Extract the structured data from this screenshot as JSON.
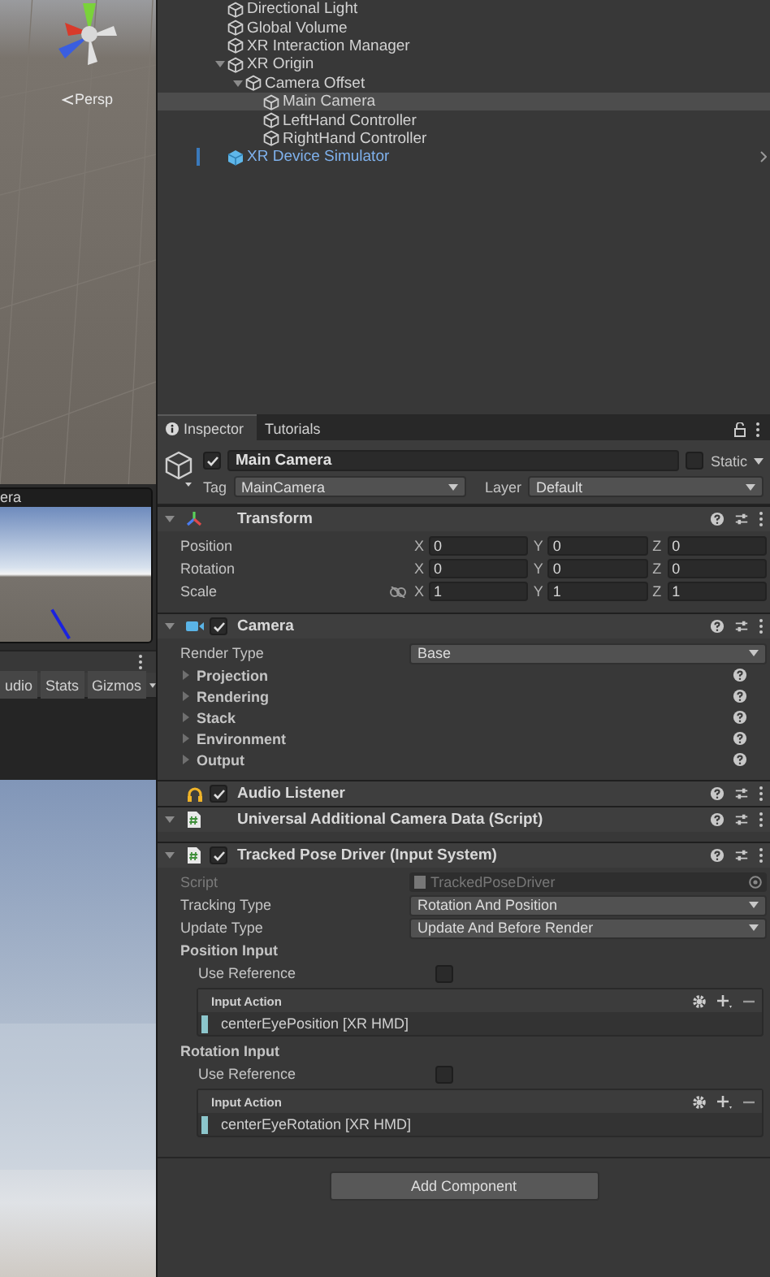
{
  "scene_view": {
    "view_label": "Persp"
  },
  "camera_preview": {
    "title": "era"
  },
  "game_toolbar": {
    "buttons": [
      "udio",
      "Stats",
      "Gizmos"
    ]
  },
  "hierarchy": {
    "items": [
      {
        "name": "Directional Light",
        "kind": "object",
        "selected": false
      },
      {
        "name": "Global Volume",
        "kind": "object",
        "selected": false
      },
      {
        "name": "XR Interaction Manager",
        "kind": "object",
        "selected": false
      },
      {
        "name": "XR Origin",
        "kind": "object",
        "selected": false,
        "expanded": true,
        "children": [
          {
            "name": "Camera Offset",
            "kind": "object",
            "selected": false,
            "expanded": true,
            "children": [
              {
                "name": "Main Camera",
                "kind": "object",
                "selected": true
              },
              {
                "name": "LeftHand Controller",
                "kind": "object",
                "selected": false
              },
              {
                "name": "RightHand Controller",
                "kind": "object",
                "selected": false
              }
            ]
          }
        ]
      },
      {
        "name": "XR Device Simulator",
        "kind": "prefab",
        "selected": false
      }
    ]
  },
  "inspector": {
    "tabs": [
      {
        "label": "Inspector",
        "selected": true
      },
      {
        "label": "Tutorials",
        "selected": false
      }
    ],
    "object": {
      "active": true,
      "name": "Main Camera",
      "static_label": "Static",
      "static": false,
      "tag_label": "Tag",
      "tag": "MainCamera",
      "layer_label": "Layer",
      "layer": "Default"
    },
    "components": [
      {
        "title": "Transform",
        "kind": "transform",
        "expanded": true,
        "rows": [
          {
            "kind": "vector",
            "label": "Position",
            "values": [
              {
                "axis": "X",
                "value": "0"
              },
              {
                "axis": "Y",
                "value": "0"
              },
              {
                "axis": "Z",
                "value": "0"
              }
            ]
          },
          {
            "kind": "vector",
            "label": "Rotation",
            "values": [
              {
                "axis": "X",
                "value": "0"
              },
              {
                "axis": "Y",
                "value": "0"
              },
              {
                "axis": "Z",
                "value": "0"
              }
            ]
          },
          {
            "kind": "vector",
            "label": "Scale",
            "constrained": false,
            "values": [
              {
                "axis": "X",
                "value": "1"
              },
              {
                "axis": "Y",
                "value": "1"
              },
              {
                "axis": "Z",
                "value": "1"
              }
            ]
          }
        ]
      },
      {
        "title": "Camera",
        "kind": "camera",
        "enabled": true,
        "expanded": true,
        "rows": [
          {
            "kind": "dropdown",
            "label": "Render Type",
            "value": "Base"
          },
          {
            "kind": "foldout",
            "label": "Projection",
            "expanded": false
          },
          {
            "kind": "foldout",
            "label": "Rendering",
            "expanded": false
          },
          {
            "kind": "foldout",
            "label": "Stack",
            "expanded": false
          },
          {
            "kind": "foldout",
            "label": "Environment",
            "expanded": false
          },
          {
            "kind": "foldout",
            "label": "Output",
            "expanded": false
          }
        ]
      },
      {
        "title": "Audio Listener",
        "kind": "audio",
        "enabled": true
      },
      {
        "title": "Universal Additional Camera Data (Script)",
        "kind": "script",
        "expanded": true
      },
      {
        "title": "Tracked Pose Driver (Input System)",
        "kind": "script",
        "enabled": true,
        "expanded": true,
        "rows": [
          {
            "kind": "object",
            "label": "Script",
            "value": "TrackedPoseDriver",
            "disabled": true
          },
          {
            "kind": "dropdown",
            "label": "Tracking Type",
            "value": "Rotation And Position"
          },
          {
            "kind": "dropdown",
            "label": "Update Type",
            "value": "Update And Before Render"
          },
          {
            "kind": "heading",
            "label": "Position Input"
          },
          {
            "kind": "checkbox",
            "label": "Use Reference",
            "checked": false
          },
          {
            "kind": "action",
            "title": "Input Action",
            "value": "centerEyePosition [XR HMD]"
          },
          {
            "kind": "heading",
            "label": "Rotation Input"
          },
          {
            "kind": "checkbox",
            "label": "Use Reference",
            "checked": false
          },
          {
            "kind": "action",
            "title": "Input Action",
            "value": "centerEyeRotation [XR HMD]"
          }
        ]
      }
    ],
    "add_button": "Add Component"
  }
}
